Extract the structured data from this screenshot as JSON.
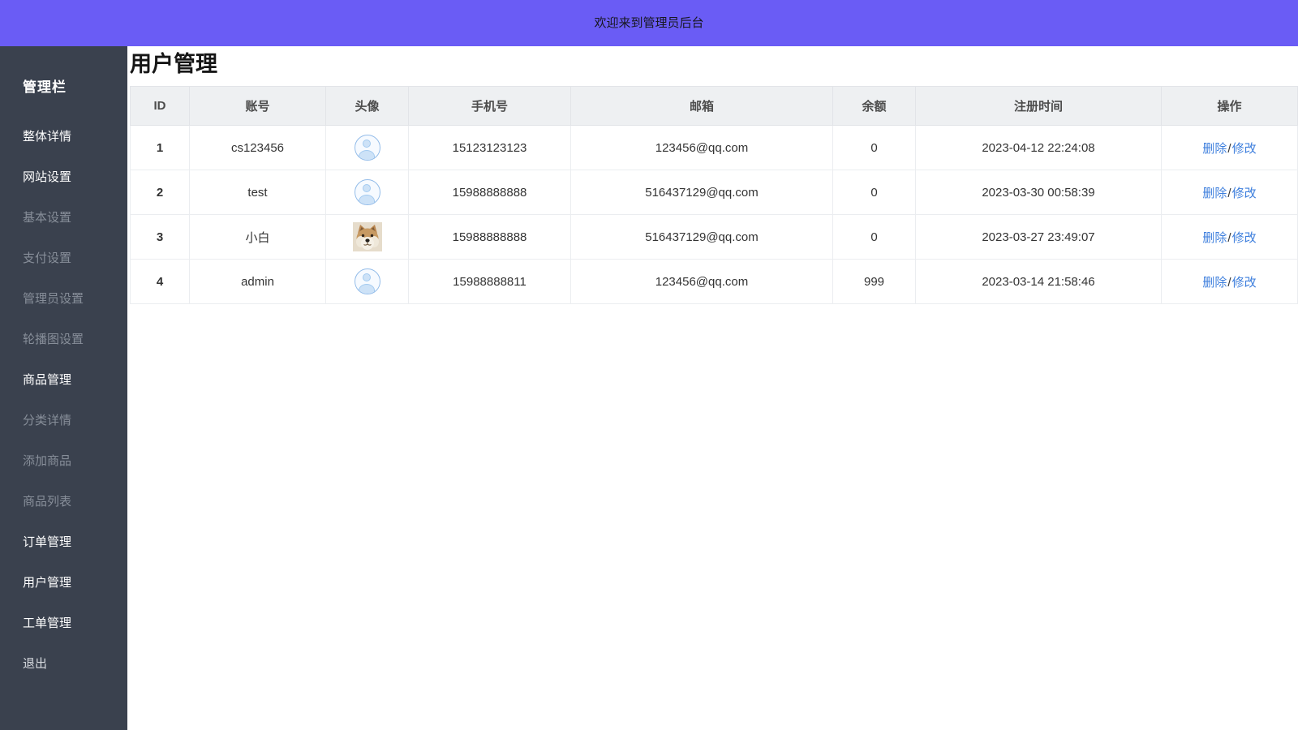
{
  "topbar": {
    "title": "欢迎来到管理员后台",
    "bg_color": "#6A5CF5"
  },
  "sidebar": {
    "title": "管理栏",
    "bg_color": "#3A414E",
    "muted_text_color": "#878E99",
    "items": [
      {
        "label": "整体详情",
        "muted": false
      },
      {
        "label": "网站设置",
        "muted": false
      },
      {
        "label": "基本设置",
        "muted": true
      },
      {
        "label": "支付设置",
        "muted": true
      },
      {
        "label": "管理员设置",
        "muted": true
      },
      {
        "label": "轮播图设置",
        "muted": true
      },
      {
        "label": "商品管理",
        "muted": false
      },
      {
        "label": "分类详情",
        "muted": true
      },
      {
        "label": "添加商品",
        "muted": true
      },
      {
        "label": "商品列表",
        "muted": true
      },
      {
        "label": "订单管理",
        "muted": false
      },
      {
        "label": "用户管理",
        "muted": false
      },
      {
        "label": "工单管理",
        "muted": false
      },
      {
        "label": "退出",
        "muted": false
      }
    ]
  },
  "main": {
    "title": "用户管理",
    "table": {
      "header_bg_color": "#EEF0F2",
      "link_color": "#3E7FDD",
      "columns": [
        "ID",
        "账号",
        "头像",
        "手机号",
        "邮箱",
        "余额",
        "注册时间",
        "操作"
      ],
      "actions": {
        "delete": "删除",
        "separator": "/",
        "modify": "修改"
      },
      "rows": [
        {
          "id": "1",
          "account": "cs123456",
          "avatar": "default-user-icon",
          "phone": "15123123123",
          "email": "123456@qq.com",
          "balance": "0",
          "registered": "2023-04-12 22:24:08"
        },
        {
          "id": "2",
          "account": "test",
          "avatar": "default-user-icon",
          "phone": "15988888888",
          "email": "516437129@qq.com",
          "balance": "0",
          "registered": "2023-03-30 00:58:39"
        },
        {
          "id": "3",
          "account": "小白",
          "avatar": "dog-photo",
          "phone": "15988888888",
          "email": "516437129@qq.com",
          "balance": "0",
          "registered": "2023-03-27 23:49:07"
        },
        {
          "id": "4",
          "account": "admin",
          "avatar": "default-user-icon",
          "phone": "15988888811",
          "email": "123456@qq.com",
          "balance": "999",
          "registered": "2023-03-14 21:58:46"
        }
      ]
    }
  }
}
